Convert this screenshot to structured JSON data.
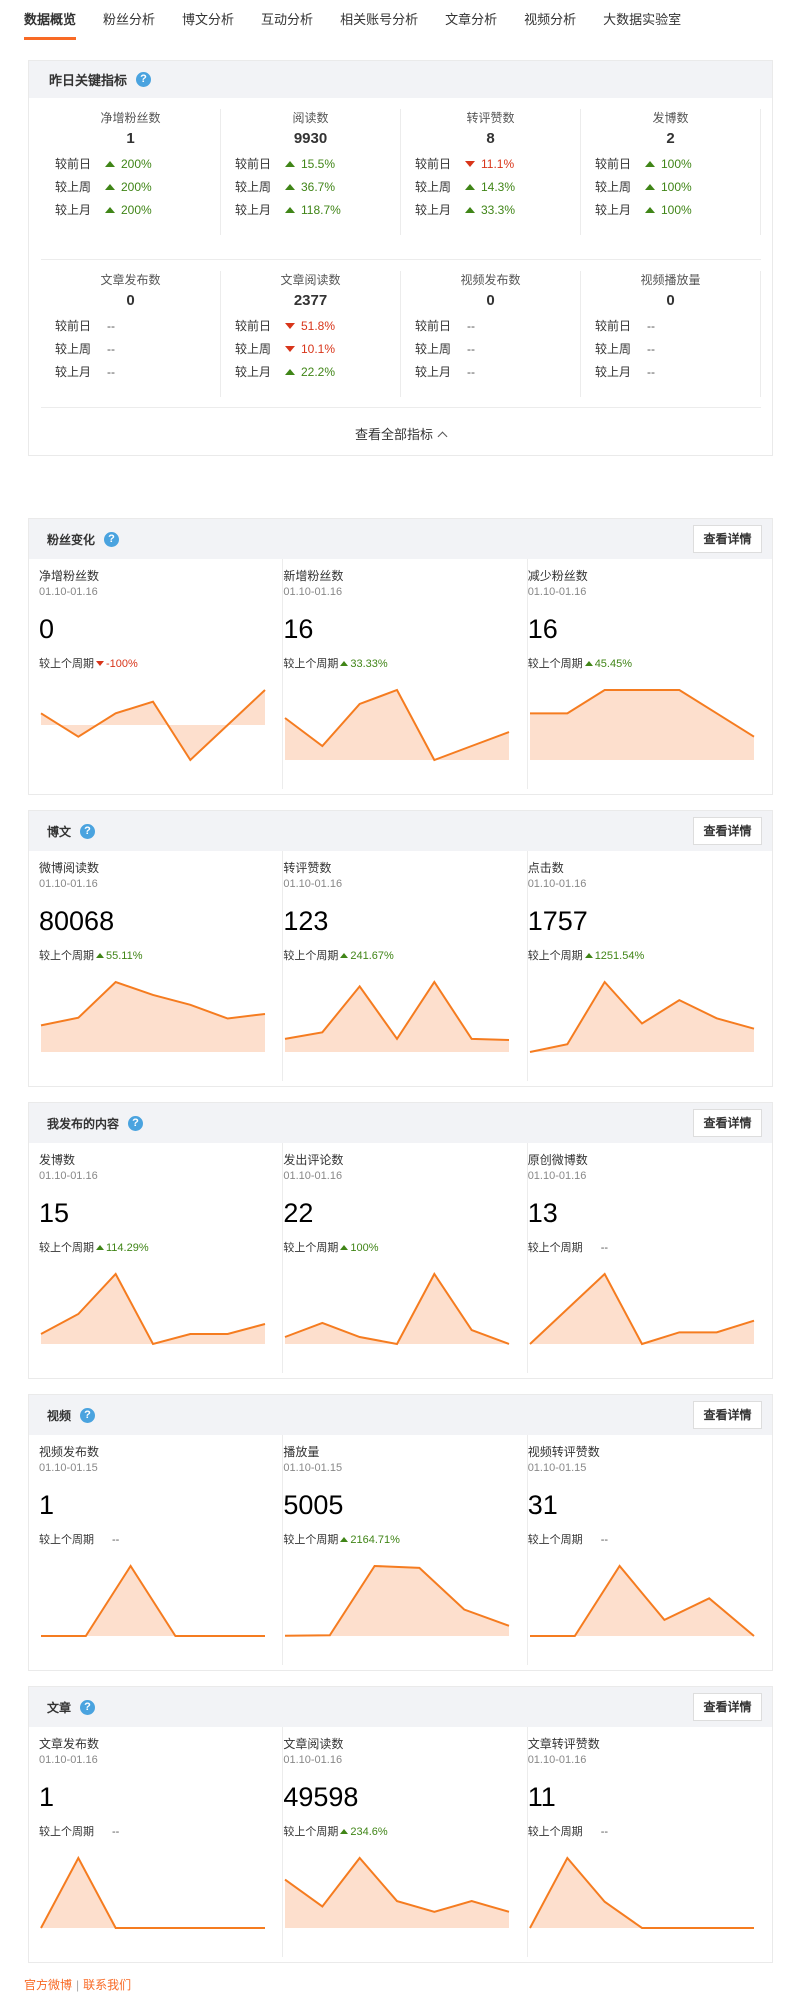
{
  "tabs": [
    "数据概览",
    "粉丝分析",
    "博文分析",
    "互动分析",
    "相关账号分析",
    "文章分析",
    "视频分析",
    "大数据实验室"
  ],
  "key_metrics": {
    "title": "昨日关键指标",
    "help": "?",
    "compare_labels": [
      "较前日",
      "较上周",
      "较上月"
    ],
    "row1": [
      {
        "name": "净增粉丝数",
        "value": "1",
        "cmp": [
          {
            "dir": "up",
            "v": "200%"
          },
          {
            "dir": "up",
            "v": "200%"
          },
          {
            "dir": "up",
            "v": "200%"
          }
        ]
      },
      {
        "name": "阅读数",
        "value": "9930",
        "cmp": [
          {
            "dir": "up",
            "v": "15.5%"
          },
          {
            "dir": "up",
            "v": "36.7%"
          },
          {
            "dir": "up",
            "v": "118.7%"
          }
        ]
      },
      {
        "name": "转评赞数",
        "value": "8",
        "cmp": [
          {
            "dir": "down",
            "v": "11.1%"
          },
          {
            "dir": "up",
            "v": "14.3%"
          },
          {
            "dir": "up",
            "v": "33.3%"
          }
        ]
      },
      {
        "name": "发博数",
        "value": "2",
        "cmp": [
          {
            "dir": "up",
            "v": "100%"
          },
          {
            "dir": "up",
            "v": "100%"
          },
          {
            "dir": "up",
            "v": "100%"
          }
        ]
      }
    ],
    "row2": [
      {
        "name": "文章发布数",
        "value": "0",
        "cmp": [
          {
            "dir": "none",
            "v": "--"
          },
          {
            "dir": "none",
            "v": "--"
          },
          {
            "dir": "none",
            "v": "--"
          }
        ]
      },
      {
        "name": "文章阅读数",
        "value": "2377",
        "cmp": [
          {
            "dir": "down",
            "v": "51.8%"
          },
          {
            "dir": "down",
            "v": "10.1%"
          },
          {
            "dir": "up",
            "v": "22.2%"
          }
        ]
      },
      {
        "name": "视频发布数",
        "value": "0",
        "cmp": [
          {
            "dir": "none",
            "v": "--"
          },
          {
            "dir": "none",
            "v": "--"
          },
          {
            "dir": "none",
            "v": "--"
          }
        ]
      },
      {
        "name": "视频播放量",
        "value": "0",
        "cmp": [
          {
            "dir": "none",
            "v": "--"
          },
          {
            "dir": "none",
            "v": "--"
          },
          {
            "dir": "none",
            "v": "--"
          }
        ]
      }
    ],
    "view_all": "查看全部指标"
  },
  "detail_label": "查看详情",
  "compare_prefix": "较上个周期",
  "sections": [
    {
      "title": "粉丝变化",
      "help": true,
      "cards": [
        {
          "title": "净增粉丝数",
          "date": "01.10-01.16",
          "value": "0",
          "dir": "down",
          "pct": "-100%",
          "spark": [
            1,
            -1,
            1,
            2,
            -3,
            0,
            3
          ],
          "spark_signed": true
        },
        {
          "title": "新增粉丝数",
          "date": "01.10-01.16",
          "value": "16",
          "dir": "up",
          "pct": "33.33%",
          "spark": [
            3,
            1,
            4,
            5,
            0,
            1,
            2
          ]
        },
        {
          "title": "减少粉丝数",
          "date": "01.10-01.16",
          "value": "16",
          "dir": "up",
          "pct": "45.45%",
          "spark": [
            2,
            2,
            3,
            3,
            3,
            2,
            1
          ]
        }
      ]
    },
    {
      "title": "博文",
      "help": true,
      "cards": [
        {
          "title": "微博阅读数",
          "date": "01.10-01.16",
          "value": "80068",
          "dir": "up",
          "pct": "55.11%",
          "spark": [
            3.5,
            4.5,
            9.2,
            7.5,
            6.2,
            4.4,
            5.0
          ]
        },
        {
          "title": "转评赞数",
          "date": "01.10-01.16",
          "value": "123",
          "dir": "up",
          "pct": "241.67%",
          "spark": [
            6,
            9,
            30,
            6,
            32,
            6,
            5.5
          ]
        },
        {
          "title": "点击数",
          "date": "01.10-01.16",
          "value": "1757",
          "dir": "up",
          "pct": "1251.54%",
          "spark": [
            0,
            30,
            270,
            110,
            200,
            130,
            90
          ]
        }
      ]
    },
    {
      "title": "我发布的内容",
      "help": true,
      "cards": [
        {
          "title": "发博数",
          "date": "01.10-01.16",
          "value": "15",
          "dir": "up",
          "pct": "114.29%",
          "spark": [
            1,
            3,
            7,
            0,
            1,
            1,
            2
          ]
        },
        {
          "title": "发出评论数",
          "date": "01.10-01.16",
          "value": "22",
          "dir": "up",
          "pct": "100%",
          "spark": [
            1,
            3,
            1,
            0,
            10,
            2,
            0
          ]
        },
        {
          "title": "原创微博数",
          "date": "01.10-01.16",
          "value": "13",
          "dir": "none",
          "pct": "--",
          "spark": [
            0,
            3,
            6,
            0,
            1,
            1,
            2
          ]
        }
      ]
    },
    {
      "title": "视频",
      "help": true,
      "cards": [
        {
          "title": "视频发布数",
          "date": "01.10-01.15",
          "value": "1",
          "dir": "none",
          "pct": "--",
          "spark": [
            0,
            0,
            1,
            0,
            0,
            0
          ]
        },
        {
          "title": "播放量",
          "date": "01.10-01.15",
          "value": "5005",
          "dir": "up",
          "pct": "2164.71%",
          "spark": [
            5,
            20,
            1850,
            1800,
            700,
            270
          ]
        },
        {
          "title": "视频转评赞数",
          "date": "01.10-01.15",
          "value": "31",
          "dir": "none",
          "pct": "--",
          "spark": [
            0,
            0,
            13,
            3,
            7,
            0
          ]
        }
      ]
    },
    {
      "title": "文章",
      "help": true,
      "cards": [
        {
          "title": "文章发布数",
          "date": "01.10-01.16",
          "value": "1",
          "dir": "none",
          "pct": "--",
          "spark": [
            0,
            1,
            0,
            0,
            0,
            0,
            0
          ]
        },
        {
          "title": "文章阅读数",
          "date": "01.10-01.16",
          "value": "49598",
          "dir": "up",
          "pct": "234.6%",
          "spark": [
            9,
            4,
            13,
            5,
            3,
            5,
            3
          ]
        },
        {
          "title": "文章转评赞数",
          "date": "01.10-01.16",
          "value": "11",
          "dir": "none",
          "pct": "--",
          "spark": [
            0,
            8,
            3,
            0,
            0,
            0,
            0
          ]
        }
      ]
    }
  ],
  "footer": {
    "link1": "官方微博",
    "link2": "联系我们"
  },
  "colors": {
    "accent": "#f86a25",
    "line": "#f57c20",
    "fill": "#fddfcd",
    "up": "#408517",
    "down": "#d8351a"
  }
}
